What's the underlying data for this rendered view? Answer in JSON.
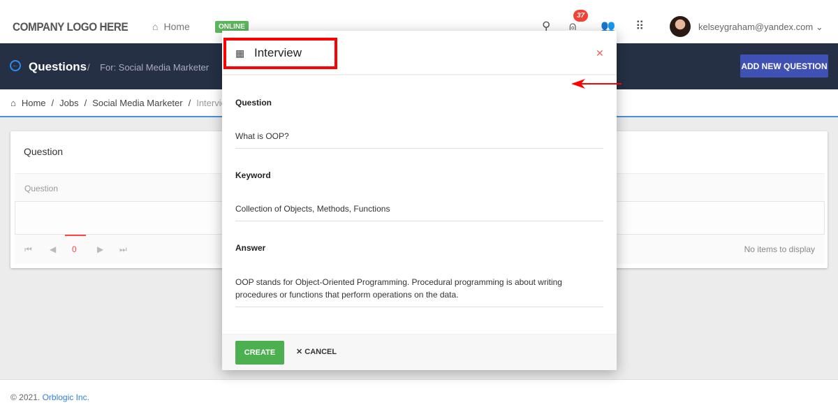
{
  "topbar": {
    "logo": "COMPANY LOGO HERE",
    "home": "Home",
    "status": "ONLINE",
    "notifications": "37",
    "user_email": "kelseygraham@yandex.com",
    "icons": [
      "search-icon",
      "bell-icon",
      "users-icon",
      "apps-grid-icon"
    ]
  },
  "header": {
    "title": "Questions",
    "subtitle": "For: Social Media Marketer",
    "add_button": "ADD NEW QUESTION",
    "color": "#253045",
    "accent": "#3f51b5"
  },
  "breadcrumb": [
    "Home",
    "/",
    "Jobs",
    "/",
    "Social Media Marketer",
    "/",
    "Intervie"
  ],
  "card": {
    "title": "Question",
    "column": "Question",
    "page": "0",
    "empty": "No items to display"
  },
  "footer": {
    "copyright": "© 2021.",
    "company": "Orblogic Inc."
  },
  "modal": {
    "title": "Interview",
    "question_label": "Question",
    "question_value": "What is OOP?",
    "keyword_label": "Keyword",
    "keyword_value": "Collection of Objects, Methods, Functions",
    "answer_label": "Answer",
    "answer_value": "OOP stands for Object-Oriented Programming. Procedural programming is about writing procedures or functions that perform operations on the data.",
    "create": "CREATE",
    "cancel": "CANCEL",
    "highlight_color": "#ff0000"
  }
}
